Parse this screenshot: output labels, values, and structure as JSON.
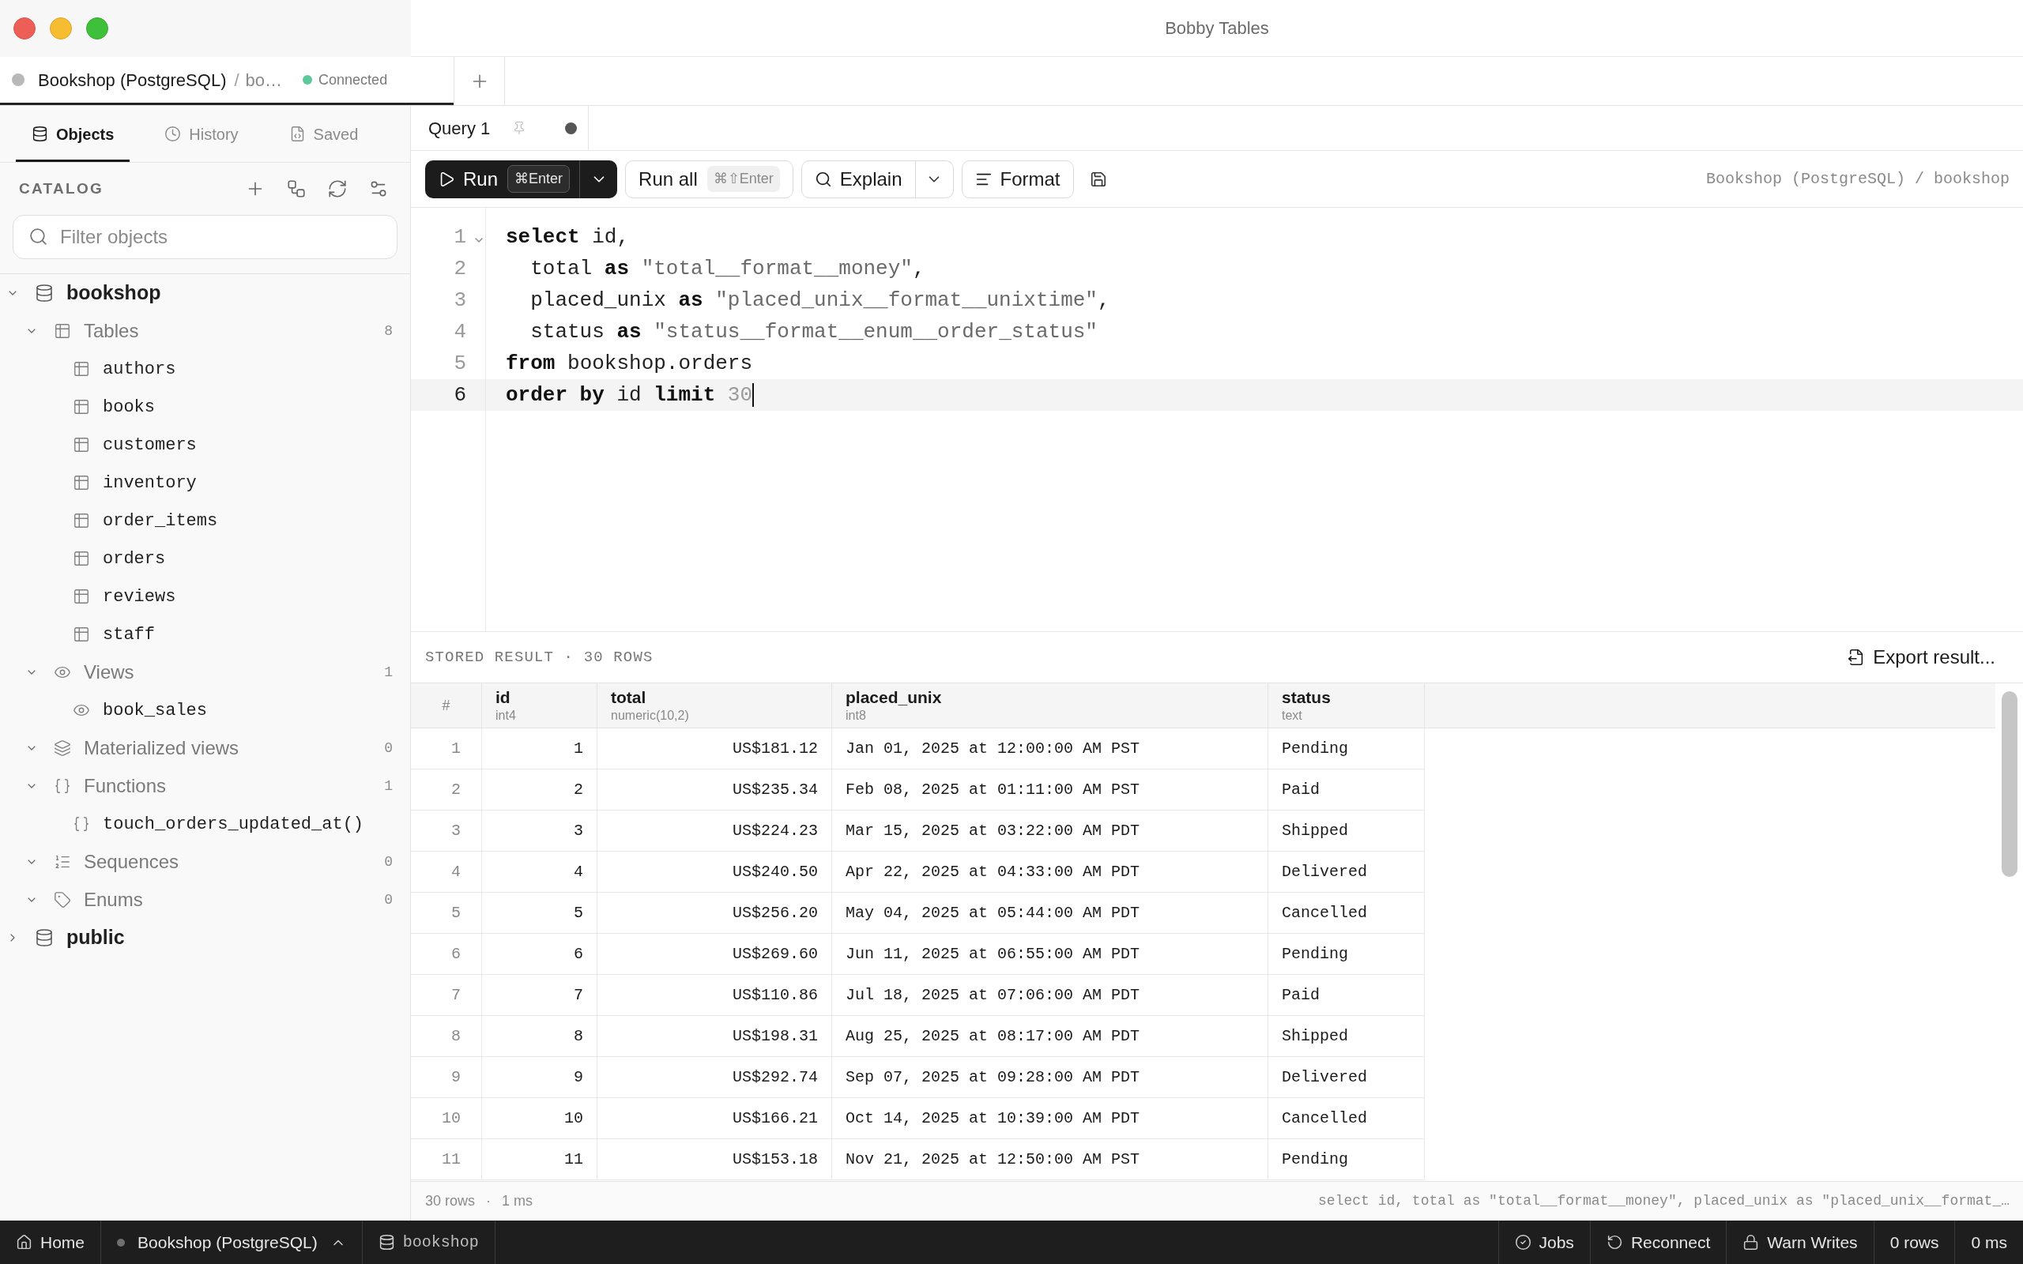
{
  "window": {
    "title": "Bobby Tables"
  },
  "connection_tabs": [
    {
      "name": "Bookshop (PostgreSQL)",
      "separator": "/",
      "database": "bo…",
      "color": "#b8b8b8",
      "status": {
        "label": "Connected",
        "color": "#5dc99b"
      },
      "selected": true
    }
  ],
  "sidebar": {
    "tabs": [
      {
        "label": "Objects",
        "selected": true
      },
      {
        "label": "History",
        "selected": false
      },
      {
        "label": "Saved",
        "selected": false
      }
    ],
    "catalog_title": "CATALOG",
    "filter": {
      "placeholder": "Filter objects"
    },
    "tree": [
      {
        "kind": "database",
        "label": "bookshop",
        "expanded": true,
        "children": [
          {
            "kind": "tables",
            "label": "Tables",
            "count": "8",
            "expanded": true,
            "children": [
              {
                "kind": "table",
                "label": "authors"
              },
              {
                "kind": "table",
                "label": "books"
              },
              {
                "kind": "table",
                "label": "customers"
              },
              {
                "kind": "table",
                "label": "inventory"
              },
              {
                "kind": "table",
                "label": "order_items"
              },
              {
                "kind": "table",
                "label": "orders"
              },
              {
                "kind": "table",
                "label": "reviews"
              },
              {
                "kind": "table",
                "label": "staff"
              }
            ]
          },
          {
            "kind": "views",
            "label": "Views",
            "count": "1",
            "expanded": true,
            "children": [
              {
                "kind": "view",
                "label": "book_sales"
              }
            ]
          },
          {
            "kind": "materialized_views",
            "label": "Materialized views",
            "count": "0",
            "expanded": true
          },
          {
            "kind": "functions",
            "label": "Functions",
            "count": "1",
            "expanded": true,
            "children": [
              {
                "kind": "function",
                "label": "touch_orders_updated_at()"
              }
            ]
          },
          {
            "kind": "sequences",
            "label": "Sequences",
            "count": "0",
            "expanded": true
          },
          {
            "kind": "enums",
            "label": "Enums",
            "count": "0",
            "expanded": true
          }
        ]
      },
      {
        "kind": "database",
        "label": "public",
        "expanded": false
      }
    ]
  },
  "query_tabs": [
    {
      "label": "Query 1",
      "pinned": false,
      "unsaved": true,
      "selected": true
    }
  ],
  "toolbar": {
    "buttons": [
      {
        "kind": "run",
        "label": "Run",
        "shortcut": "⌘Enter",
        "menu": true
      },
      {
        "kind": "run_all",
        "label": "Run all",
        "shortcut": "⌘⇧Enter",
        "menu": false
      },
      {
        "kind": "explain",
        "label": "Explain",
        "menu": true
      },
      {
        "kind": "format",
        "label": "Format",
        "menu": false
      },
      {
        "kind": "save",
        "menu": false
      }
    ],
    "context": "Bookshop (PostgreSQL) / bookshop"
  },
  "editor": {
    "lines": [
      {
        "number": "1",
        "foldable": true,
        "current": false,
        "tokens": [
          {
            "kind": "keyword",
            "text": "select"
          },
          {
            "kind": "plain",
            "text": " id,"
          }
        ]
      },
      {
        "number": "2",
        "foldable": false,
        "current": false,
        "tokens": [
          {
            "kind": "plain",
            "text": "  total "
          },
          {
            "kind": "keyword",
            "text": "as"
          },
          {
            "kind": "string",
            "text": " \"total__format__money\""
          },
          {
            "kind": "plain",
            "text": ","
          }
        ]
      },
      {
        "number": "3",
        "foldable": false,
        "current": false,
        "tokens": [
          {
            "kind": "plain",
            "text": "  placed_unix "
          },
          {
            "kind": "keyword",
            "text": "as"
          },
          {
            "kind": "string",
            "text": " \"placed_unix__format__unixtime\""
          },
          {
            "kind": "plain",
            "text": ","
          }
        ]
      },
      {
        "number": "4",
        "foldable": false,
        "current": false,
        "tokens": [
          {
            "kind": "plain",
            "text": "  status "
          },
          {
            "kind": "keyword",
            "text": "as"
          },
          {
            "kind": "string",
            "text": " \"status__format__enum__order_status\""
          }
        ]
      },
      {
        "number": "5",
        "foldable": false,
        "current": false,
        "tokens": [
          {
            "kind": "keyword",
            "text": "from"
          },
          {
            "kind": "plain",
            "text": " bookshop.orders"
          }
        ]
      },
      {
        "number": "6",
        "foldable": false,
        "current": true,
        "tokens": [
          {
            "kind": "keyword",
            "text": "order by"
          },
          {
            "kind": "plain",
            "text": " id "
          },
          {
            "kind": "keyword",
            "text": "limit"
          },
          {
            "kind": "number",
            "text": " 30"
          }
        ]
      }
    ]
  },
  "result": {
    "title": "STORED RESULT · 30 ROWS",
    "export_label": "Export result...",
    "columns": [
      {
        "name": "#",
        "kind": "index"
      },
      {
        "name": "id",
        "type": "int4",
        "kind": "number"
      },
      {
        "name": "total",
        "type": "numeric(10,2)",
        "kind": "number"
      },
      {
        "name": "placed_unix",
        "type": "int8",
        "kind": "text"
      },
      {
        "name": "status",
        "type": "text",
        "kind": "text"
      }
    ],
    "rows": [
      {
        "cells": [
          "1",
          "1",
          "US$181.12",
          "Jan 01, 2025 at 12:00:00 AM PST",
          "Pending"
        ]
      },
      {
        "cells": [
          "2",
          "2",
          "US$235.34",
          "Feb 08, 2025 at 01:11:00 AM PST",
          "Paid"
        ]
      },
      {
        "cells": [
          "3",
          "3",
          "US$224.23",
          "Mar 15, 2025 at 03:22:00 AM PDT",
          "Shipped"
        ]
      },
      {
        "cells": [
          "4",
          "4",
          "US$240.50",
          "Apr 22, 2025 at 04:33:00 AM PDT",
          "Delivered"
        ]
      },
      {
        "cells": [
          "5",
          "5",
          "US$256.20",
          "May 04, 2025 at 05:44:00 AM PDT",
          "Cancelled"
        ]
      },
      {
        "cells": [
          "6",
          "6",
          "US$269.60",
          "Jun 11, 2025 at 06:55:00 AM PDT",
          "Pending"
        ]
      },
      {
        "cells": [
          "7",
          "7",
          "US$110.86",
          "Jul 18, 2025 at 07:06:00 AM PDT",
          "Paid"
        ]
      },
      {
        "cells": [
          "8",
          "8",
          "US$198.31",
          "Aug 25, 2025 at 08:17:00 AM PDT",
          "Shipped"
        ]
      },
      {
        "cells": [
          "9",
          "9",
          "US$292.74",
          "Sep 07, 2025 at 09:28:00 AM PDT",
          "Delivered"
        ]
      },
      {
        "cells": [
          "10",
          "10",
          "US$166.21",
          "Oct 14, 2025 at 10:39:00 AM PDT",
          "Cancelled"
        ]
      },
      {
        "cells": [
          "11",
          "11",
          "US$153.18",
          "Nov 21, 2025 at 12:50:00 AM PST",
          "Pending"
        ]
      }
    ]
  },
  "footer": {
    "row_count": "30 rows",
    "separator": "·",
    "duration": "1 ms",
    "query": "select id, total as \"total__format__money\", placed_unix as \"placed_unix__format_…"
  },
  "status_bar": {
    "left": [
      {
        "kind": "home",
        "label": "Home"
      },
      {
        "kind": "connection",
        "label": "Bookshop (PostgreSQL)"
      },
      {
        "kind": "database",
        "label": "bookshop"
      }
    ],
    "right": [
      {
        "kind": "jobs",
        "label": "Jobs"
      },
      {
        "kind": "reconnect",
        "label": "Reconnect"
      },
      {
        "kind": "warn_writes",
        "label": "Warn Writes"
      },
      {
        "kind": "count",
        "label": "0 rows"
      },
      {
        "kind": "timing",
        "label": "0 ms"
      }
    ]
  }
}
